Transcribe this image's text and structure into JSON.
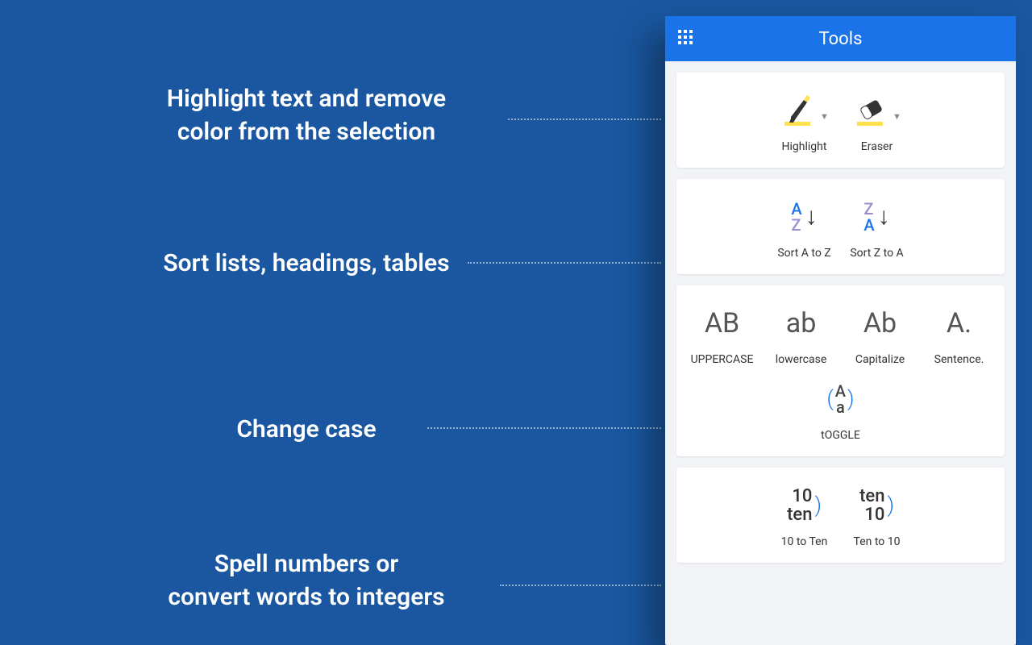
{
  "descriptions": {
    "d1a": "Highlight text and remove",
    "d1b": "color from the selection",
    "d2": "Sort lists, headings, tables",
    "d3": "Change case",
    "d4a": "Spell numbers or",
    "d4b": "convert words to integers"
  },
  "panel": {
    "title": "Tools"
  },
  "tools": {
    "highlight": "Highlight",
    "eraser": "Eraser",
    "sortAZ": "Sort A to Z",
    "sortZA": "Sort Z to A",
    "uppercase": {
      "glyph": "AB",
      "label": "UPPERCASE"
    },
    "lowercase": {
      "glyph": "ab",
      "label": "lowercase"
    },
    "capitalize": {
      "glyph": "Ab",
      "label": "Capitalize"
    },
    "sentence": {
      "glyph": "A.",
      "label": "Sentence."
    },
    "toggle": {
      "label": "tOGGLE"
    },
    "tenToWord": {
      "top": "10",
      "bot": "ten",
      "label": "10 to Ten"
    },
    "wordToTen": {
      "top": "ten",
      "bot": "10",
      "label": "Ten to 10"
    }
  },
  "glyphs": {
    "sortAZ_top": "A",
    "sortAZ_bot": "Z",
    "sortZA_top": "Z",
    "sortZA_bot": "A",
    "toggle_top": "A",
    "toggle_bot": "a"
  },
  "colors": {
    "blue": "#1a73e8",
    "purple": "#9b8cce"
  }
}
